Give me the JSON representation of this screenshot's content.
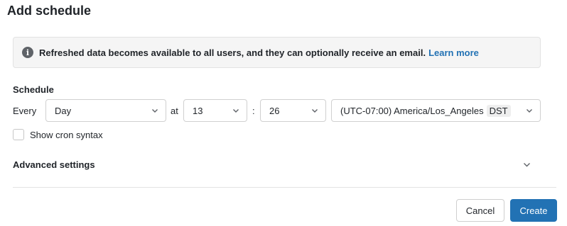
{
  "dialog": {
    "title": "Add schedule"
  },
  "banner": {
    "icon": "info-icon",
    "text": "Refreshed data becomes available to all users, and they can optionally receive an email.",
    "link_label": "Learn more",
    "link_color": "#2272b4"
  },
  "schedule": {
    "section_label": "Schedule",
    "every_label": "Every",
    "frequency_value": "Day",
    "at_label": "at",
    "hour_value": "13",
    "colon": ":",
    "minute_value": "26",
    "timezone_value": "(UTC-07:00) America/Los_Angeles",
    "dst_tag": "DST",
    "cron_checkbox_label": "Show cron syntax",
    "cron_checked": false
  },
  "advanced": {
    "label": "Advanced settings",
    "icon": "chevron-down-icon"
  },
  "footer": {
    "cancel_label": "Cancel",
    "create_label": "Create",
    "primary_color": "#2272b4"
  }
}
